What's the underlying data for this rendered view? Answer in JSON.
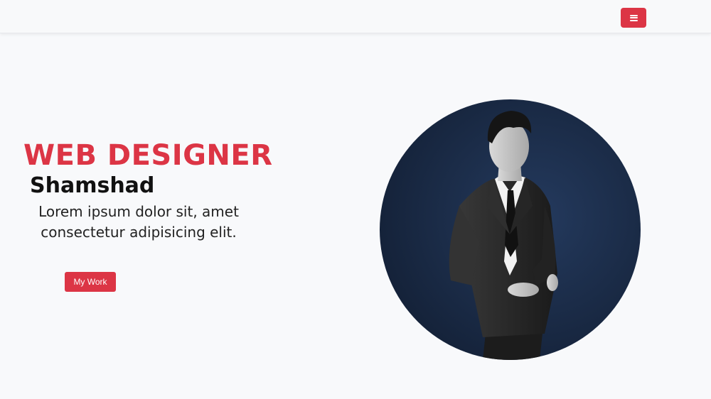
{
  "navbar": {
    "menu_icon": "hamburger-icon",
    "accent_color": "#dc3545"
  },
  "hero": {
    "title": "WEB DESIGNER",
    "name": "Shamshad",
    "tagline": "Lorem ipsum dolor sit, amet consectetur adipisicing elit.",
    "cta_label": "My Work"
  }
}
